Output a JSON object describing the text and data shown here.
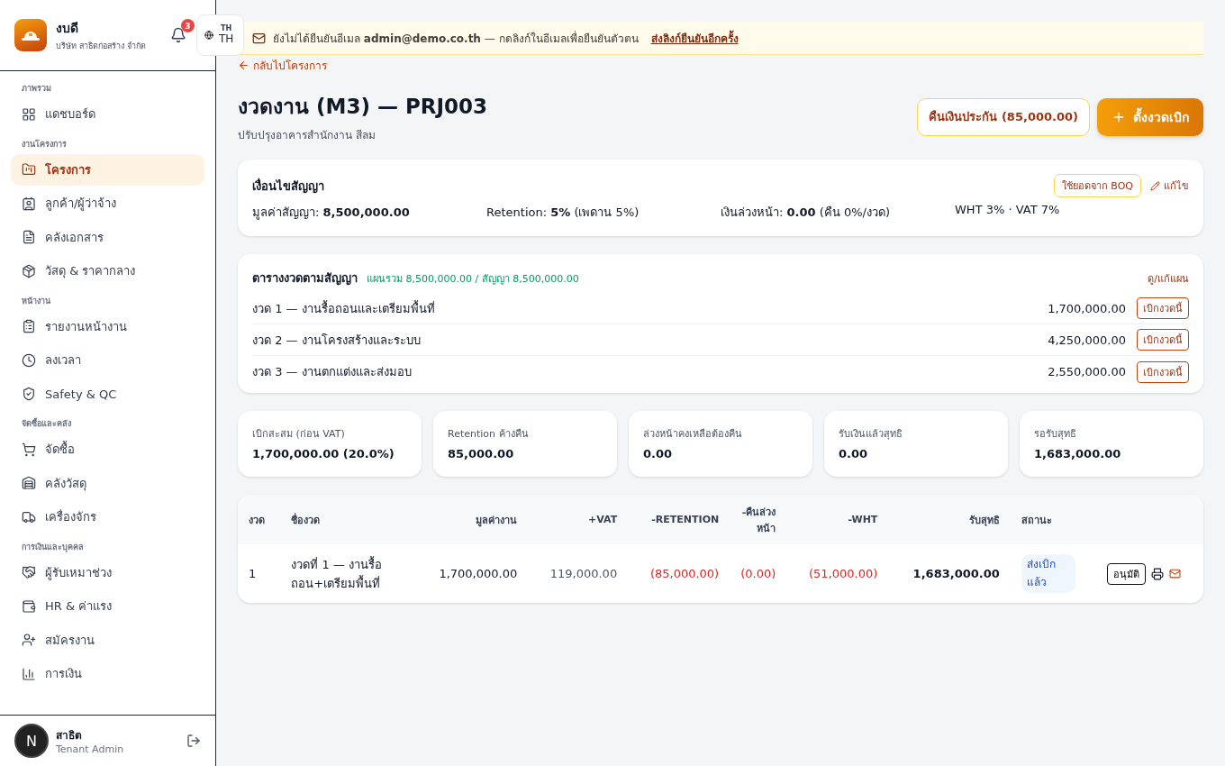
{
  "sidebar": {
    "brand": {
      "name": "งบดี",
      "company": "บริษัท สาธิตก่อสร้าง จำกัด"
    },
    "notifications": "3",
    "language": {
      "small": "TH",
      "code": "TH"
    },
    "sections": [
      {
        "title": "ภาพรวม",
        "items": [
          {
            "label": "แดชบอร์ด",
            "selected": false
          }
        ]
      },
      {
        "title": "งานโครงการ",
        "items": [
          {
            "label": "โครงการ",
            "selected": true
          },
          {
            "label": "ลูกค้า/ผู้ว่าจ้าง",
            "selected": false
          },
          {
            "label": "คลังเอกสาร",
            "selected": false
          },
          {
            "label": "วัสดุ & ราคากลาง",
            "selected": false
          }
        ]
      },
      {
        "title": "หน้างาน",
        "items": [
          {
            "label": "รายงานหน้างาน",
            "selected": false
          },
          {
            "label": "ลงเวลา",
            "selected": false
          },
          {
            "label": "Safety & QC",
            "selected": false
          }
        ]
      },
      {
        "title": "จัดซื้อและคลัง",
        "items": [
          {
            "label": "จัดซื้อ",
            "selected": false
          },
          {
            "label": "คลังวัสดุ",
            "selected": false
          },
          {
            "label": "เครื่องจักร",
            "selected": false
          }
        ]
      },
      {
        "title": "การเงินและบุคคล",
        "items": [
          {
            "label": "ผู้รับเหมาช่วง",
            "selected": false
          },
          {
            "label": "HR & ค่าแรง",
            "selected": false
          },
          {
            "label": "สมัครงาน",
            "selected": false
          },
          {
            "label": "การเงิน",
            "selected": false
          }
        ]
      }
    ],
    "user": {
      "name": "สาธิต",
      "role": "Tenant Admin",
      "avatar": "N"
    }
  },
  "banner": {
    "text": "ยังไม่ได้ยืนยันอีเมล **admin@demo.co.th** — กดลิงก์ในอีเมลเพื่อยืนยันตัวตน",
    "link": "ส่งลิงก์ยืนยันอีกครั้ง"
  },
  "back_link": "กลับไปโครงการ",
  "title": "งวดงาน (M3) — PRJ003",
  "subtitle": "ปรับปรุงอาคารสำนักงาน สีลม",
  "actions": {
    "refund": "คืนเงินประกัน (85,000.00)",
    "create": "ตั้งงวดเบิก"
  },
  "contract": {
    "title": "เงื่อนไขสัญญา",
    "boq_button": "ใช้ยอดจาก BOQ",
    "edit": "แก้ไข",
    "facts": [
      "มูลค่าสัญญา: **8,500,000.00**",
      "Retention: **5%** (เพดาน 5%)",
      "เงินล่วงหน้า: **0.00** (คืน 0%/งวด)",
      "WHT 3% · VAT 7%"
    ]
  },
  "schedule": {
    "title": "ตารางงวดตามสัญญา",
    "summary": "แผนรวม 8,500,000.00 / สัญญา 8,500,000.00",
    "link": "ดู/แก้แผน",
    "rows": [
      {
        "label": "งวด 1 — งานรื้อถอนและเตรียมพื้นที่",
        "amount": "1,700,000.00",
        "action": "เบิกงวดนี้"
      },
      {
        "label": "งวด 2 — งานโครงสร้างและระบบ",
        "amount": "4,250,000.00",
        "action": "เบิกงวดนี้"
      },
      {
        "label": "งวด 3 — งานตกแต่งและส่งมอบ",
        "amount": "2,550,000.00",
        "action": "เบิกงวดนี้"
      }
    ]
  },
  "stats": [
    {
      "label": "เบิกสะสม (ก่อน VAT)",
      "value": "1,700,000.00 (20.0%)"
    },
    {
      "label": "Retention ค้างคืน",
      "value": "85,000.00"
    },
    {
      "label": "ล่วงหน้าคงเหลือต้องคืน",
      "value": "0.00"
    },
    {
      "label": "รับเงินแล้วสุทธิ",
      "value": "0.00"
    },
    {
      "label": "รอรับสุทธิ",
      "value": "1,683,000.00"
    }
  ],
  "table": {
    "columns": [
      "งวด",
      "ชื่องวด",
      "มูลค่างาน",
      "+VAT",
      "-RETENTION",
      "-คืนล่วงหน้า",
      "-WHT",
      "รับสุทธิ",
      "สถานะ"
    ],
    "rows": [
      {
        "number": "1",
        "name": "งวดที่ 1 — งานรื้อถอน+เตรียมพื้นที่",
        "value": "1,700,000.00",
        "vat": "119,000.00",
        "retention": "(85,000.00)",
        "advance": "(0.00)",
        "wht": "(51,000.00)",
        "net": "1,683,000.00",
        "status": "ส่งเบิกแล้ว",
        "approve": "อนุมัติ"
      }
    ]
  }
}
